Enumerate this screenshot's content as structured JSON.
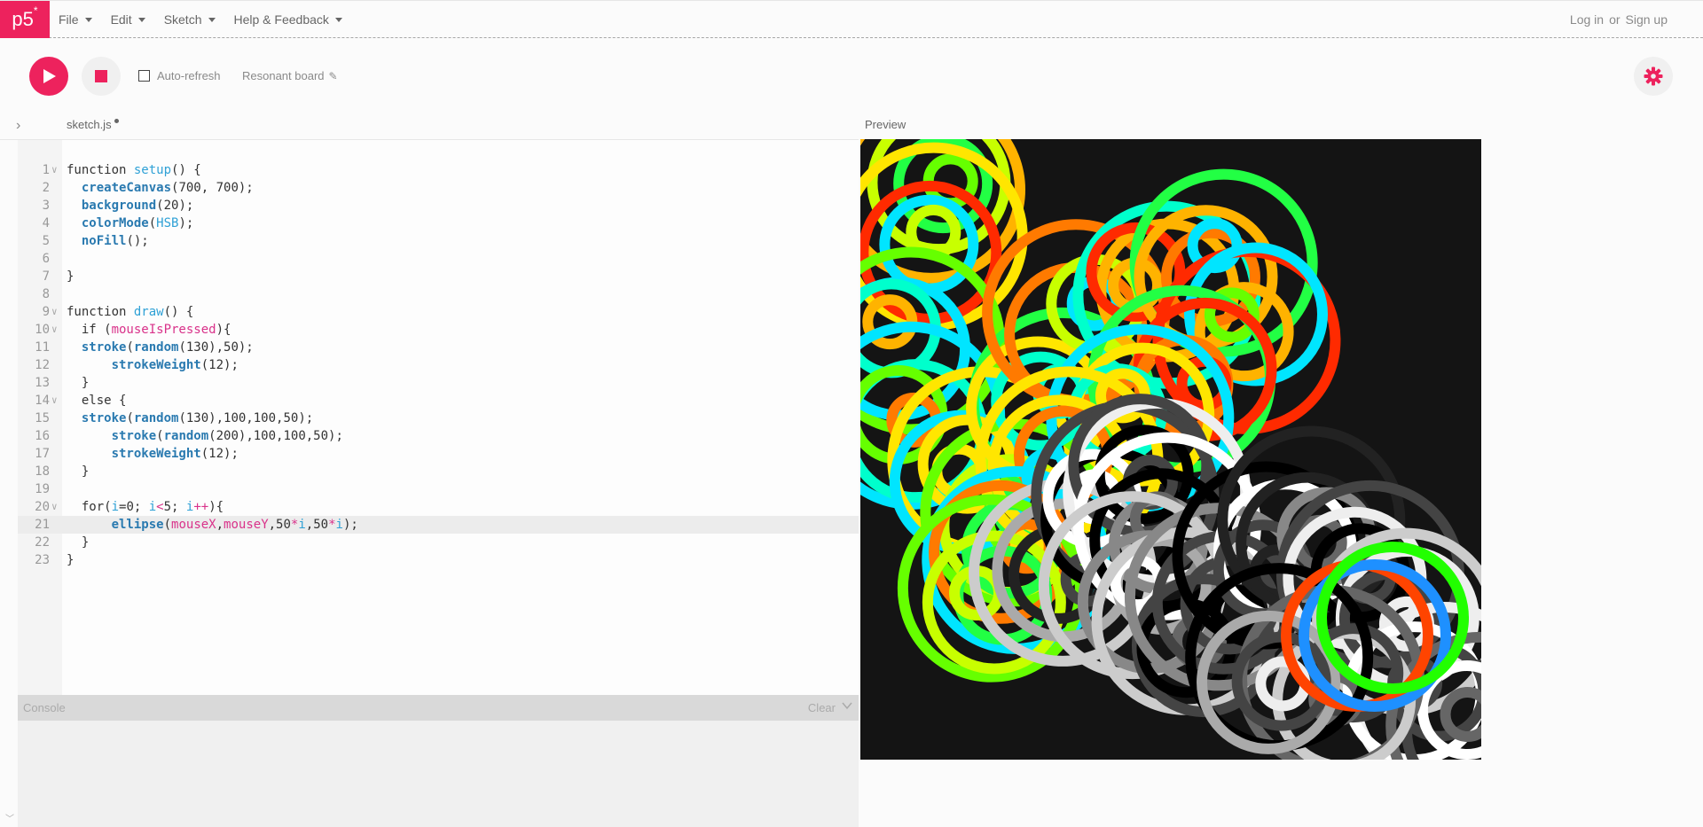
{
  "nav": {
    "logo": "p5",
    "logo_star": "*",
    "menu": [
      {
        "label": "File"
      },
      {
        "label": "Edit"
      },
      {
        "label": "Sketch"
      },
      {
        "label": "Help & Feedback"
      }
    ],
    "login": "Log in",
    "or": "or",
    "signup": "Sign up"
  },
  "toolbar": {
    "play_icon": "play-icon",
    "stop_icon": "stop-icon",
    "auto_refresh_label": "Auto-refresh",
    "auto_refresh_checked": false,
    "project_name": "Resonant board",
    "settings_icon": "gear-icon"
  },
  "editor": {
    "file_name": "sketch.js",
    "unsaved": true,
    "active_line": 21,
    "line_numbers": [
      "1",
      "2",
      "3",
      "4",
      "5",
      "6",
      "7",
      "8",
      "9",
      "10",
      "11",
      "12",
      "13",
      "14",
      "15",
      "16",
      "17",
      "18",
      "19",
      "20",
      "21",
      "22",
      "23"
    ],
    "foldable_lines": [
      1,
      9,
      10,
      14,
      20
    ],
    "lines": [
      "function setup() {",
      "  createCanvas(700, 700);",
      "  background(20);",
      "  colorMode(HSB);",
      "  noFill();",
      "",
      "}",
      "",
      "function draw() {",
      "  if (mouseIsPressed){",
      "  stroke(random(130),50);",
      "      strokeWeight(12);",
      "  }",
      "  else {",
      "  stroke(random(130),100,100,50);",
      "      stroke(random(200),100,100,50);",
      "      strokeWeight(12);",
      "  }",
      "",
      "  for(i=0; i<5; i++){",
      "      ellipse(mouseX,mouseY,50*i,50*i);",
      "  }",
      "}"
    ]
  },
  "preview": {
    "label": "Preview",
    "canvas_background": "#141414"
  },
  "console": {
    "title": "Console",
    "clear": "Clear"
  },
  "colors": {
    "accent": "#ed225d",
    "function_blue": "#2a7ab0",
    "name_blue": "#2fa1d6",
    "variable_pink": "#d9328a"
  }
}
